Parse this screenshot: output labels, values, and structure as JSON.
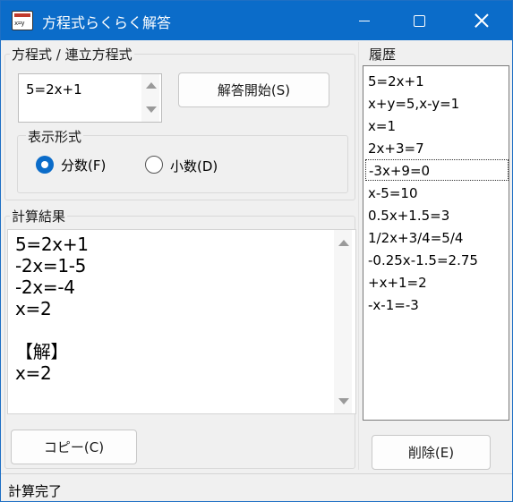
{
  "window": {
    "title": "方程式らくらく解答",
    "app_icon_text": "x=y",
    "minimize_icon": "minimize-icon",
    "maximize_icon": "maximize-icon",
    "close_icon": "close-icon",
    "accent_color": "#0b6cc9"
  },
  "equation_group": {
    "label": "方程式 / 連立方程式",
    "input_value": "5=2x+1",
    "solve_button": "解答開始(S)"
  },
  "format_group": {
    "label": "表示形式",
    "options": [
      {
        "label": "分数(F)",
        "checked": true
      },
      {
        "label": "小数(D)",
        "checked": false
      }
    ]
  },
  "result_group": {
    "label": "計算結果",
    "text": "5=2x+1\n-2x=1-5\n-2x=-4\nx=2\n\n【解】\nx=2",
    "copy_button": "コピー(C)"
  },
  "history_group": {
    "label": "履歴",
    "items": [
      "5=2x+1",
      "x+y=5,x-y=1",
      "x=1",
      "2x+3=7",
      "-3x+9=0",
      "x-5=10",
      "0.5x+1.5=3",
      "1/2x+3/4=5/4",
      "-0.25x-1.5=2.75",
      "+x+1=2",
      "-x-1=-3"
    ],
    "focused_index": 4,
    "delete_button": "削除(E)"
  },
  "status": {
    "text": "計算完了"
  }
}
